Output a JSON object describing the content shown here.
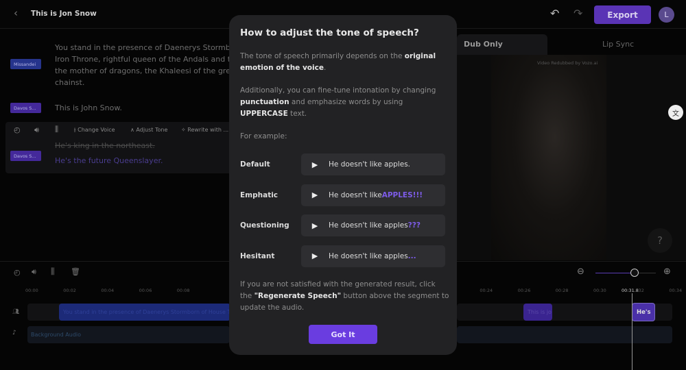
{
  "header": {
    "title": "This is Jon Snow",
    "export_label": "Export",
    "avatar_initial": "L"
  },
  "script": {
    "segments": [
      {
        "speaker": "Missandei",
        "text_lines": [
          "You stand in the presence of Daenerys Stormborn",
          "Iron Throne, rightful queen of the Andals and the f",
          "the mother of dragons, the Khaleesi of the great G",
          "chainst."
        ]
      },
      {
        "speaker": "Davos S...",
        "text": "This is John Snow."
      },
      {
        "speaker": "Davos S...",
        "original": "He's king in the northeast.",
        "text": "He's the future Queenslayer."
      }
    ],
    "toolbar": {
      "change_voice": "Change Voice",
      "adjust_tone": "Adjust Tone",
      "rewrite": "Rewrite with ..."
    }
  },
  "preview": {
    "tabs": [
      {
        "label": "Dub Only",
        "active": true
      },
      {
        "label": "Lip Sync",
        "active": false
      }
    ],
    "watermark": "Video Redubbed by Vozo.ai",
    "help": "?"
  },
  "modal": {
    "title": "How to adjust the tone of speech?",
    "p1_a": "The tone of speech primarily depends on the ",
    "p1_b": "original emotion of the voice",
    "p1_c": ".",
    "p2_a": "Additionally, you can fine-tune intonation by changing ",
    "p2_b": "punctuation",
    "p2_c": " and emphasize words by using ",
    "p2_d": "UPPERCASE",
    "p2_e": " text.",
    "for_example": "For example:",
    "examples": [
      {
        "label": "Default",
        "text": "He doesn't like apples.",
        "highlight": ""
      },
      {
        "label": "Emphatic",
        "text": "He doesn't like ",
        "highlight": "APPLES!!!"
      },
      {
        "label": "Questioning",
        "text": "He doesn't like apples",
        "highlight": "???"
      },
      {
        "label": "Hesitant",
        "text": "He doesn't like apples",
        "highlight": "..."
      }
    ],
    "p3_a": "If you are not satisfied with the generated result, click the ",
    "p3_b": "\"Regenerate Speech\"",
    "p3_c": " button above the segment to update the audio.",
    "button": "Got It"
  },
  "timeline": {
    "ticks": [
      "00:00",
      "00:02",
      "00:04",
      "00:06",
      "00:08",
      "00:24",
      "00:26",
      "00:28",
      "00:30",
      "00:32",
      "00:34"
    ],
    "playhead": "00:31.8",
    "zoom_level": 0.65,
    "clips": [
      "You stand in the presence of Daenerys Stormborn of House T",
      "This is jo",
      "He's"
    ],
    "background_audio": "Background Audio"
  },
  "colors": {
    "accent": "#6a3de0",
    "speaker_blue": "#2c3a9a",
    "speaker_purple": "#4a2f9e"
  }
}
